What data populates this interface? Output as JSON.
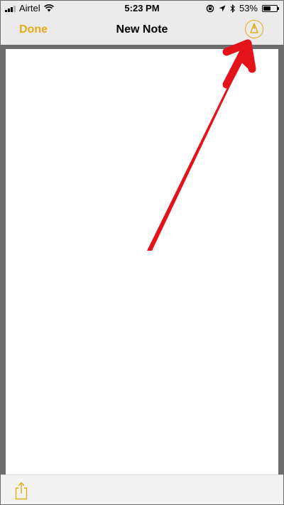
{
  "status_bar": {
    "carrier": "Airtel",
    "time": "5:23 PM",
    "battery": "53%",
    "battery_level": 0.53,
    "icons": [
      "signal-icon",
      "wifi-icon",
      "screen-rotation-lock-icon",
      "location-icon",
      "bluetooth-icon",
      "battery-icon"
    ]
  },
  "nav": {
    "done_label": "Done",
    "title": "New Note",
    "markup_icon": "markup-pen-icon"
  },
  "note": {
    "body_text": ""
  },
  "toolbar": {
    "share_icon": "share-icon"
  },
  "colors": {
    "accent": "#e5aa1a",
    "annotation_arrow": "#e3121b",
    "bar_background": "#ebebeb",
    "well_background": "#6d6d6d"
  }
}
